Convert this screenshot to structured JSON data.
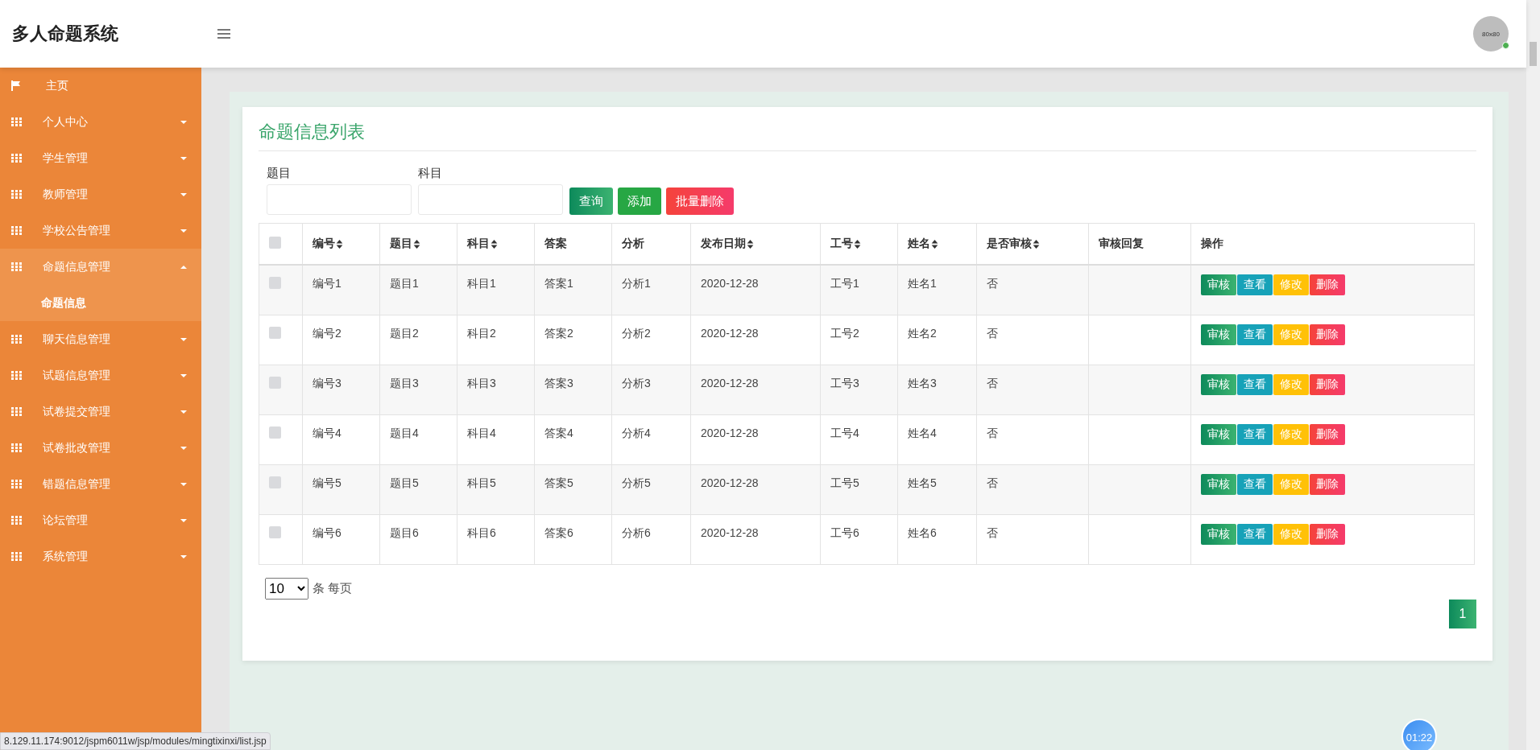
{
  "header": {
    "title": "多人命题系统",
    "avatar_text": "80x80"
  },
  "sidebar": {
    "items": [
      {
        "kind": "link",
        "label": "主页"
      },
      {
        "kind": "group",
        "label": "个人中心",
        "expanded": false
      },
      {
        "kind": "group",
        "label": "学生管理",
        "expanded": false
      },
      {
        "kind": "group",
        "label": "教师管理",
        "expanded": false
      },
      {
        "kind": "group",
        "label": "学校公告管理",
        "expanded": false
      },
      {
        "kind": "group",
        "label": "命题信息管理",
        "expanded": true,
        "children": [
          {
            "label": "命题信息",
            "selected": true
          }
        ]
      },
      {
        "kind": "group",
        "label": "聊天信息管理",
        "expanded": false
      },
      {
        "kind": "group",
        "label": "试题信息管理",
        "expanded": false
      },
      {
        "kind": "group",
        "label": "试卷提交管理",
        "expanded": false
      },
      {
        "kind": "group",
        "label": "试卷批改管理",
        "expanded": false
      },
      {
        "kind": "group",
        "label": "错题信息管理",
        "expanded": false
      },
      {
        "kind": "group",
        "label": "论坛管理",
        "expanded": false
      },
      {
        "kind": "group",
        "label": "系统管理",
        "expanded": false
      }
    ]
  },
  "page_title": "命题信息列表",
  "search": {
    "fields": [
      {
        "label": "题目"
      },
      {
        "label": "科目"
      }
    ],
    "buttons": [
      {
        "kind": "query",
        "label": "查询"
      },
      {
        "kind": "add",
        "label": "添加"
      },
      {
        "kind": "delete",
        "label": "批量删除"
      }
    ]
  },
  "table": {
    "select_all_checked": false,
    "columns": [
      {
        "label": "编号",
        "sortable": true
      },
      {
        "label": "题目",
        "sortable": true
      },
      {
        "label": "科目",
        "sortable": true
      },
      {
        "label": "答案",
        "sortable": false
      },
      {
        "label": "分析",
        "sortable": false
      },
      {
        "label": "发布日期",
        "sortable": true
      },
      {
        "label": "工号",
        "sortable": true
      },
      {
        "label": "姓名",
        "sortable": true
      },
      {
        "label": "是否审核",
        "sortable": true
      },
      {
        "label": "审核回复",
        "sortable": false
      },
      {
        "label": "操作",
        "sortable": false
      }
    ],
    "rows": [
      {
        "checked": false,
        "cells": [
          "编号1",
          "题目1",
          "科目1",
          "答案1",
          "分析1",
          "2020-12-28",
          "工号1",
          "姓名1",
          "否",
          ""
        ],
        "actions": [
          {
            "kind": "review",
            "label": "审核"
          },
          {
            "kind": "view",
            "label": "查看"
          },
          {
            "kind": "edit",
            "label": "修改"
          },
          {
            "kind": "delete",
            "label": "删除"
          }
        ]
      },
      {
        "checked": false,
        "cells": [
          "编号2",
          "题目2",
          "科目2",
          "答案2",
          "分析2",
          "2020-12-28",
          "工号2",
          "姓名2",
          "否",
          ""
        ],
        "actions": [
          {
            "kind": "review",
            "label": "审核"
          },
          {
            "kind": "view",
            "label": "查看"
          },
          {
            "kind": "edit",
            "label": "修改"
          },
          {
            "kind": "delete",
            "label": "删除"
          }
        ]
      },
      {
        "checked": false,
        "cells": [
          "编号3",
          "题目3",
          "科目3",
          "答案3",
          "分析3",
          "2020-12-28",
          "工号3",
          "姓名3",
          "否",
          ""
        ],
        "actions": [
          {
            "kind": "review",
            "label": "审核"
          },
          {
            "kind": "view",
            "label": "查看"
          },
          {
            "kind": "edit",
            "label": "修改"
          },
          {
            "kind": "delete",
            "label": "删除"
          }
        ]
      },
      {
        "checked": false,
        "cells": [
          "编号4",
          "题目4",
          "科目4",
          "答案4",
          "分析4",
          "2020-12-28",
          "工号4",
          "姓名4",
          "否",
          ""
        ],
        "actions": [
          {
            "kind": "review",
            "label": "审核"
          },
          {
            "kind": "view",
            "label": "查看"
          },
          {
            "kind": "edit",
            "label": "修改"
          },
          {
            "kind": "delete",
            "label": "删除"
          }
        ]
      },
      {
        "checked": false,
        "cells": [
          "编号5",
          "题目5",
          "科目5",
          "答案5",
          "分析5",
          "2020-12-28",
          "工号5",
          "姓名5",
          "否",
          ""
        ],
        "actions": [
          {
            "kind": "review",
            "label": "审核"
          },
          {
            "kind": "view",
            "label": "查看"
          },
          {
            "kind": "edit",
            "label": "修改"
          },
          {
            "kind": "delete",
            "label": "删除"
          }
        ]
      },
      {
        "checked": false,
        "cells": [
          "编号6",
          "题目6",
          "科目6",
          "答案6",
          "分析6",
          "2020-12-28",
          "工号6",
          "姓名6",
          "否",
          ""
        ],
        "actions": [
          {
            "kind": "review",
            "label": "审核"
          },
          {
            "kind": "view",
            "label": "查看"
          },
          {
            "kind": "edit",
            "label": "修改"
          },
          {
            "kind": "delete",
            "label": "删除"
          }
        ]
      }
    ]
  },
  "pagination": {
    "page_size": "10",
    "per_page_label": "条 每页",
    "pages": [
      {
        "label": "1",
        "selected": true
      }
    ]
  },
  "status_url": "8.129.11.174:9012/jspm6011w/jsp/modules/mingtixinxi/list.jsp",
  "timer": "01:22"
}
